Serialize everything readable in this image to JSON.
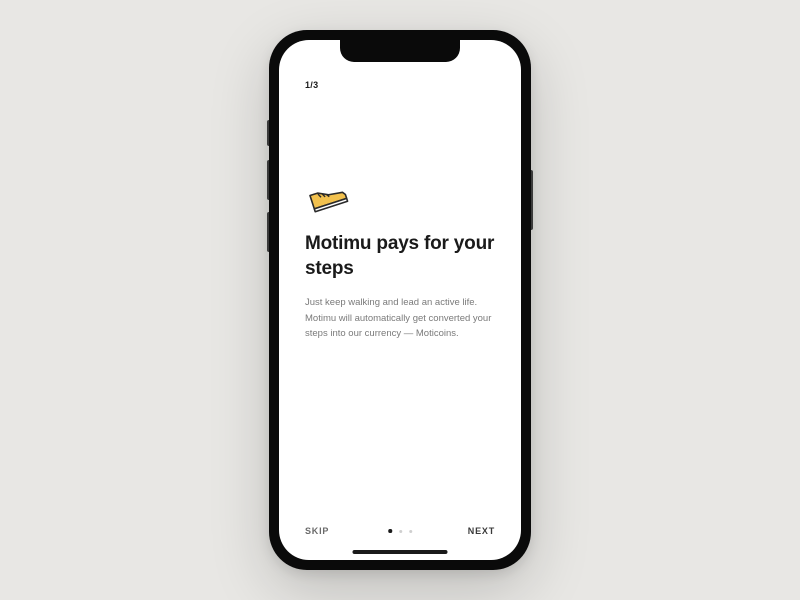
{
  "page": {
    "current": 1,
    "total": 3,
    "label": "1/3"
  },
  "onboarding": {
    "heading": "Motimu pays for your steps",
    "body": "Just keep walking and lead an active life. Motimu will automatically get converted your steps into our currency — Moticoins."
  },
  "footer": {
    "skip_label": "SKIP",
    "next_label": "NEXT"
  },
  "icon": {
    "name": "sneaker-icon",
    "accent_color": "#f2c14e",
    "stroke_color": "#2a2a2a"
  },
  "dots": {
    "count": 3,
    "active_index": 0
  }
}
